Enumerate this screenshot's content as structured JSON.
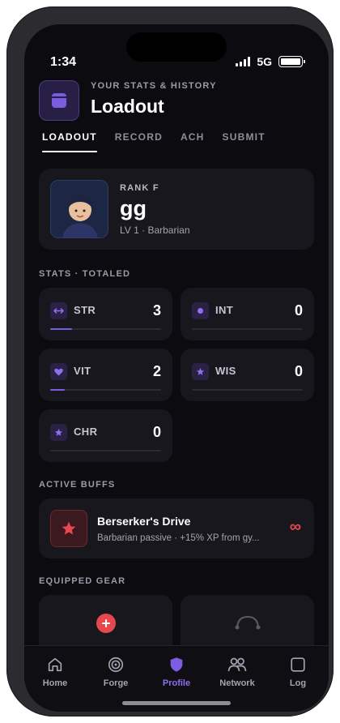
{
  "status": {
    "time": "1:34",
    "network": "5G"
  },
  "header": {
    "kicker": "YOUR STATS & HISTORY",
    "title": "Loadout"
  },
  "tabs": [
    {
      "label": "LOADOUT",
      "active": true
    },
    {
      "label": "RECORD",
      "active": false
    },
    {
      "label": "ACH",
      "active": false
    },
    {
      "label": "SUBMIT",
      "active": false
    }
  ],
  "profile": {
    "rank": "RANK F",
    "name": "gg",
    "level": "LV 1 · Barbarian"
  },
  "stats_section": {
    "title": "STATS · TOTALED"
  },
  "stats": [
    {
      "label": "STR",
      "value": "3",
      "icon": "swap-arrows-icon",
      "fill_fraction": 0.2
    },
    {
      "label": "INT",
      "value": "0",
      "icon": "dot-icon",
      "fill_fraction": 0
    },
    {
      "label": "VIT",
      "value": "2",
      "icon": "heart-icon",
      "fill_fraction": 0.13
    },
    {
      "label": "WIS",
      "value": "0",
      "icon": "star-icon",
      "fill_fraction": 0
    },
    {
      "label": "CHR",
      "value": "0",
      "icon": "star-icon",
      "fill_fraction": 0
    }
  ],
  "buffs_section": {
    "title": "ACTIVE BUFFS"
  },
  "buff": {
    "title": "Berserker's Drive",
    "description": "Barbarian passive · +15% XP from gy...",
    "duration": "∞",
    "icon": "star-icon",
    "color": "#e5484d"
  },
  "gear_section": {
    "title": "EQUIPPED GEAR"
  },
  "nav": [
    {
      "label": "Home",
      "icon": "home-icon",
      "active": false
    },
    {
      "label": "Forge",
      "icon": "target-icon",
      "active": false
    },
    {
      "label": "Profile",
      "icon": "shield-icon",
      "active": true
    },
    {
      "label": "Network",
      "icon": "people-icon",
      "active": false
    },
    {
      "label": "Log",
      "icon": "square-icon",
      "active": false
    }
  ],
  "colors": {
    "accent": "#7c5ce0",
    "background": "#0c0c10",
    "card": "#17171d",
    "danger": "#e5484d"
  }
}
